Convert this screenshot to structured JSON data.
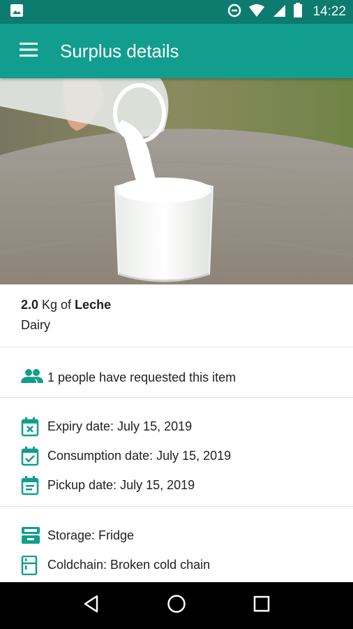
{
  "status_bar": {
    "time": "14:22",
    "icons": [
      "image-icon",
      "data-saver-icon",
      "wifi-icon",
      "signal-icon",
      "battery-icon"
    ]
  },
  "app_bar": {
    "title": "Surplus details",
    "menu_icon": "menu-icon",
    "color": "#129e8e"
  },
  "product": {
    "quantity": "2.0",
    "unit_text": " Kg of ",
    "name": "Leche",
    "category": "Dairy"
  },
  "requests": {
    "icon": "people-icon",
    "text": "1 people have requested this item"
  },
  "dates": [
    {
      "icon": "calendar-x-icon",
      "text": "Expiry date: July 15, 2019"
    },
    {
      "icon": "calendar-check-icon",
      "text": "Consumption date: July 15, 2019"
    },
    {
      "icon": "calendar-note-icon",
      "text": "Pickup date: July 15, 2019"
    }
  ],
  "storage": [
    {
      "icon": "storage-tray-icon",
      "text": "Storage: Fridge"
    },
    {
      "icon": "fridge-icon",
      "text": "Coldchain: Broken cold chain"
    }
  ],
  "nav_bar": {
    "buttons": [
      "back-icon",
      "home-icon",
      "recents-icon"
    ]
  },
  "colors": {
    "accent": "#129e8e",
    "status_bar": "#0d7c6e",
    "icon_teal": "#129e8e"
  }
}
